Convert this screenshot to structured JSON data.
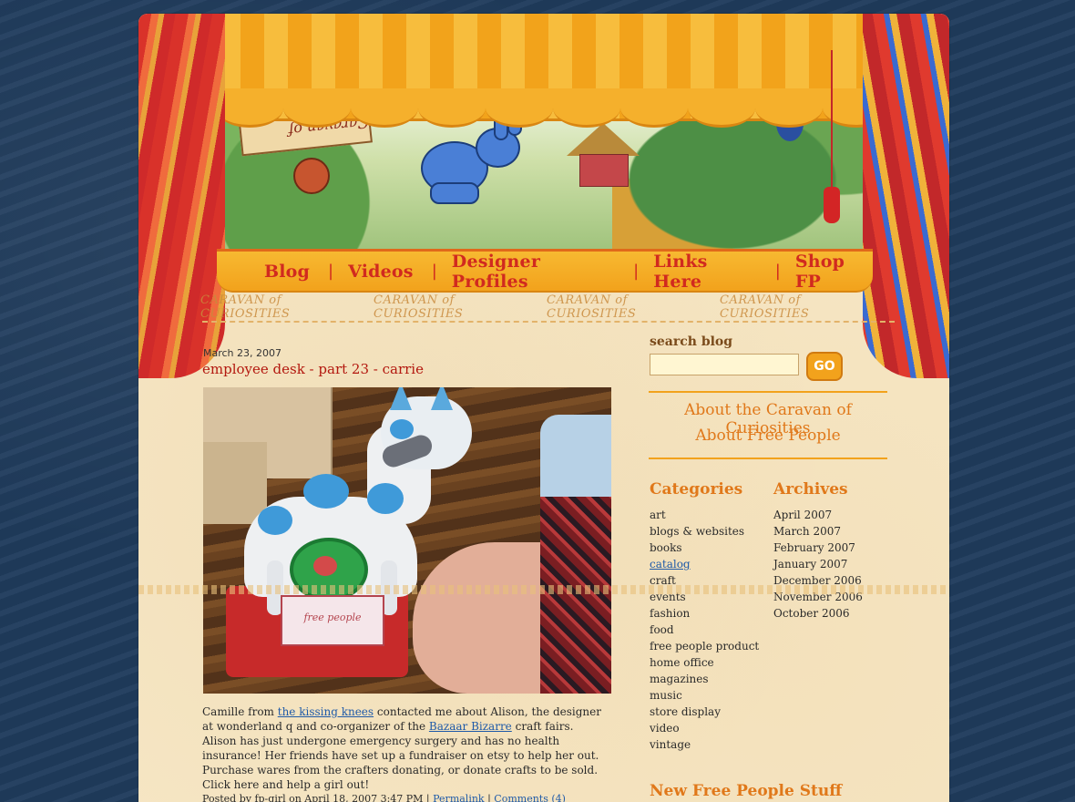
{
  "header": {
    "sign_text": "Caravan of Curiosities"
  },
  "nav": {
    "items": [
      {
        "label": "Blog"
      },
      {
        "label": "Videos"
      },
      {
        "label": "Designer Profiles"
      },
      {
        "label": "Links Here"
      },
      {
        "label": "Shop FP"
      }
    ],
    "separator": "|"
  },
  "tagline": [
    "CARAVAN of CURIOSITIES",
    "CARAVAN of CURIOSITIES",
    "CARAVAN of CURIOSITIES",
    "CARAVAN of CURIOSITIES"
  ],
  "post": {
    "date": "March 23, 2007",
    "title": "employee desk - part 23 - carrie",
    "photo_card_text": "free people",
    "body": {
      "part1": "Camille from ",
      "link1": "the kissing knees",
      "part2": " contacted me about Alison, the designer at wonderland q and co-organizer of the ",
      "link2": "Bazaar Bizarre",
      "part3": " craft fairs. Alison has just undergone emergency surgery and has no health insurance! Her friends have set up a fundraiser on etsy  to help her out. Purchase wares from the crafters donating, or donate crafts to be sold. Click here and help a girl out!"
    },
    "footer": {
      "posted": "Posted by fp-girl on April 18, 2007 3:47 PM | ",
      "permalink": "Permalink",
      "sep": " | ",
      "comments": "Comments (4)"
    }
  },
  "sidebar": {
    "search_label": "search blog",
    "search_value": "",
    "go_label": "GO",
    "about_caravan": "About the Caravan of Curiosities",
    "about_fp": "About Free People",
    "categories_heading": "Categories",
    "archives_heading": "Archives",
    "categories": [
      "art",
      "blogs & websites",
      "books",
      "catalog",
      "craft",
      "events",
      "fashion",
      "food",
      "free people product",
      "home office",
      "magazines",
      "music",
      "store display",
      "video",
      "vintage"
    ],
    "active_category": "catalog",
    "archives": [
      "April 2007",
      "March 2007",
      "February 2007",
      "January 2007",
      "December 2006",
      "November 2006",
      "October 2006"
    ],
    "new_stuff_heading": "New Free People Stuff"
  },
  "colors": {
    "background": "#1f3b5c",
    "paper": "#f6e6c4",
    "accent_orange": "#e0781a",
    "nav_red": "#d12a1f",
    "link_blue": "#1f5aa8",
    "title_red": "#b3180f"
  }
}
